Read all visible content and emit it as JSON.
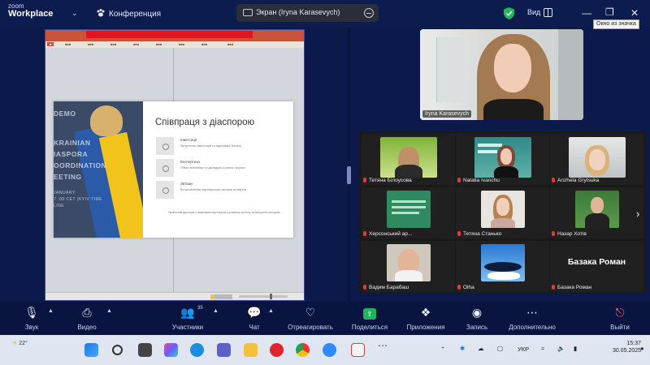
{
  "app": {
    "logo_line1": "zoom",
    "logo_line2": "Workplace"
  },
  "header": {
    "conference_label": "Конференция",
    "share_title": "Экран (Iryna Karasevych)",
    "view_label": "Вид",
    "tooltip": "Окно из значка"
  },
  "slide": {
    "title": "Співпраця з діаспорою",
    "photo_lines": [
      "DEMO",
      "KRAINIAN",
      "IASPORA",
      "OORDINATION",
      "EETING"
    ],
    "photo_small": [
      "JANUARY",
      "7 :00 CET (KYIV TIME",
      "LINE"
    ],
    "rows": [
      {
        "t1": "Інвестиції",
        "t2": "Залучення інвестицій та підтримка бізнесу"
      },
      {
        "t1": "Експертиза",
        "t2": "Обмін знаннями та досвідом у різних галузях"
      },
      {
        "t1": "Зв'язки",
        "t2": "Встановлення партнерських зв'язків та мереж"
      }
    ],
    "footer": "Українська діаспора є важливим партнером у розвитку регіону та залученні ресурсів."
  },
  "speaker": {
    "name": "Iryna Karasevych"
  },
  "gallery": {
    "tiles": [
      {
        "name": "Тетяна Білоусова"
      },
      {
        "name": "Natalia Ivanchu"
      },
      {
        "name": "Anzhela Grytsuka"
      },
      {
        "name": "Херсонський ар..."
      },
      {
        "name": "Тетяна Станько"
      },
      {
        "name": "Назар Хотів"
      },
      {
        "name": "Вадим Барабаш"
      },
      {
        "name": "Olha"
      },
      {
        "name": "Базака Роман",
        "big": "Базака Роман"
      }
    ]
  },
  "toolbar": {
    "audio": "Звук",
    "video": "Видео",
    "participants": "Участники",
    "participants_count": "35",
    "chat": "Чат",
    "react": "Отреагировать",
    "share": "Поделиться",
    "apps": "Приложения",
    "record": "Запись",
    "more": "Дополнительно",
    "leave": "Выйти"
  },
  "taskbar": {
    "weather_temp": "22°",
    "lang": "УКР",
    "time": "15:37",
    "date": "30.05.2025"
  },
  "colors": {
    "share_green": "#1fb35a",
    "muted_red": "#e03a3a",
    "ppt_accent": "#c8553b",
    "banner_red": "#e0151f"
  }
}
